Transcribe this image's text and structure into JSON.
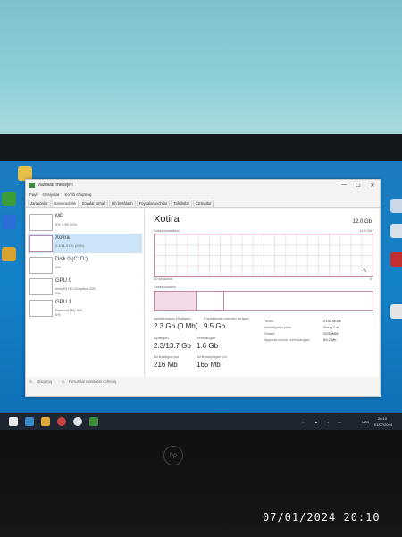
{
  "window": {
    "title": "Vazifalar menejeri",
    "menu": [
      "Fayl",
      "Opsiyalar",
      "Ko‘rib chiqmoq"
    ],
    "tabs": [
      "Jarayonlar",
      "Samaradorlik",
      "Ilovalar jurnali",
      "Ish boshlash",
      "Foydalanuvchilar",
      "Tafsilotlar",
      "Xizmatlar"
    ]
  },
  "sidebar": {
    "items": [
      {
        "name": "MP",
        "sub": "6% 3.96 GGs"
      },
      {
        "name": "Xotira",
        "sub": "2.4/11.9 Gb (20%)"
      },
      {
        "name": "Disk 0 (C: D:)",
        "sub": "0%"
      },
      {
        "name": "GPU 0",
        "sub": "Intel(R) HD Graphics 620\n0%"
      },
      {
        "name": "GPU 1",
        "sub": "Radeon(TM) 520\n0%"
      }
    ]
  },
  "main": {
    "title": "Xotira",
    "capacity": "12.0 Gb",
    "usage_label": "Xotira ishlatilishi",
    "usage_max": "11.9 Gb",
    "time_label": "60 sekunda",
    "time_right": "0",
    "composition_label": "Xotira tuzilishi",
    "stats": [
      {
        "label": "Ishlatilmoqda (Siqilgan)",
        "value": "2.3 Gb (0 Mb)"
      },
      {
        "label": "Foydalanish mumkin bo‘lgan",
        "value": "9.5 Gb"
      },
      {
        "label": "Ajratilgan",
        "value": "2.3/13.7 Gb"
      },
      {
        "label": "Keshlangan",
        "value": "1.6 Gb"
      },
      {
        "label": "Bo‘linadigan pul",
        "value": "216 Mb"
      },
      {
        "label": "Bo‘linmaydigan pul",
        "value": "165 Mb"
      }
    ],
    "kv": [
      {
        "key": "Tezlik:",
        "value": "2133 MGts"
      },
      {
        "key": "Ishlatilgan uyalar:",
        "value": "2ning 2 si"
      },
      {
        "key": "Shakli:",
        "value": "SODIMM"
      },
      {
        "key": "Apparat uchun rezervlangan:",
        "value": "83.2 Mb"
      }
    ]
  },
  "footer": {
    "fewer": "Qisqaroq",
    "monitor": "Resurslar monitorini ochmoq"
  },
  "taskbar": {
    "lang": "UZB",
    "time": "20:10",
    "date": "01/07/2024"
  },
  "photo_stamp": "07/01/2024  20:10",
  "colors": {
    "accent_memory": "#c08aa7",
    "selection": "#cce4f7",
    "desktop": "#1482c9"
  }
}
